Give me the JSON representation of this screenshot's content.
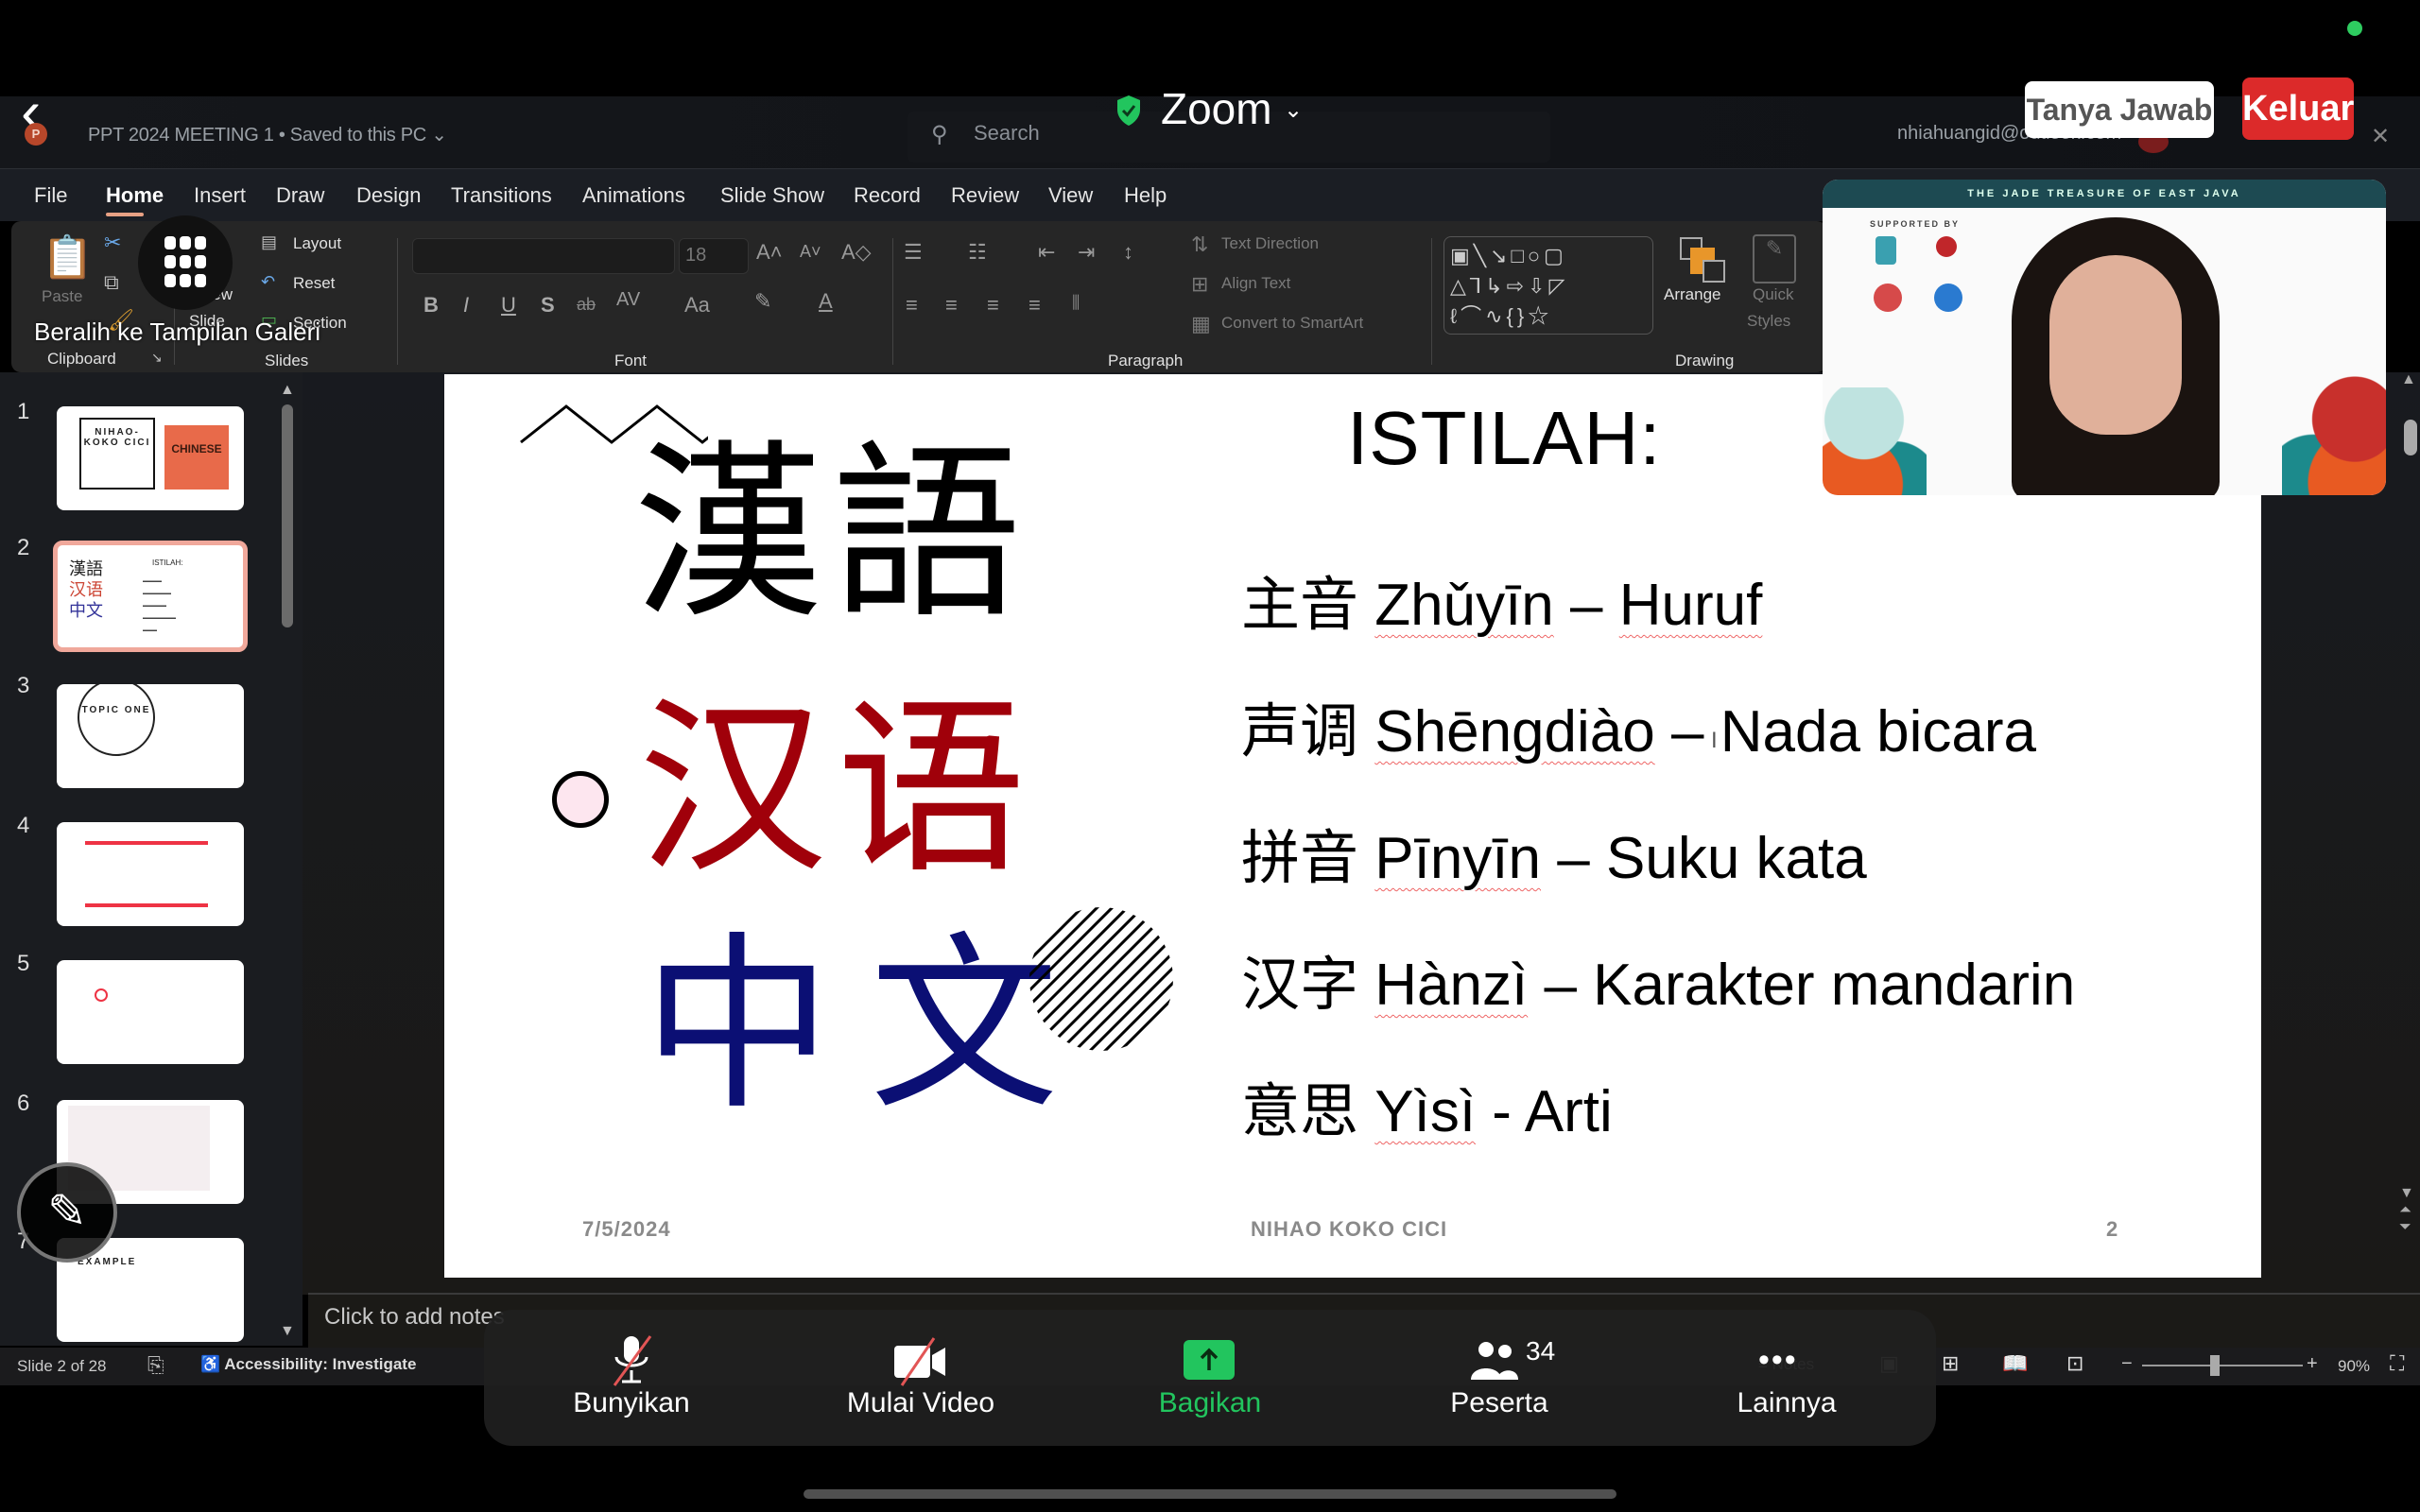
{
  "zoom_meeting": {
    "title": "Zoom",
    "qa_button": "Tanya Jawab",
    "leave_button": "Keluar",
    "controls": [
      {
        "id": "mute",
        "label": "Bunyikan",
        "icon": "microphone-muted-icon"
      },
      {
        "id": "video",
        "label": "Mulai Video",
        "icon": "video-off-icon"
      },
      {
        "id": "share",
        "label": "Bagikan",
        "icon": "share-screen-icon"
      },
      {
        "id": "participants",
        "label": "Peserta",
        "icon": "participants-icon",
        "count": "34"
      },
      {
        "id": "more",
        "label": "Lainnya",
        "icon": "more-icon"
      }
    ],
    "gallery_tooltip": "Beralih ke Tampilan Galeri",
    "video_tile": {
      "banner": "THE JADE TREASURE OF EAST JAVA",
      "supported_by": "SUPPORTED BY"
    },
    "colors": {
      "leave": "#dc2a2a",
      "share": "#22c55e",
      "status": "#2ecc60"
    }
  },
  "powerpoint": {
    "document_title": "PPT  2024 MEETING 1",
    "save_status": "Saved to this PC",
    "search_placeholder": "Search",
    "account_email": "nhiahuangid@outlook.com",
    "menu_tabs": [
      "File",
      "Home",
      "Insert",
      "Draw",
      "Design",
      "Transitions",
      "Animations",
      "Slide Show",
      "Record",
      "Review",
      "View",
      "Help"
    ],
    "active_tab": "Home",
    "ribbon": {
      "clipboard": {
        "group": "Clipboard",
        "paste": "Paste"
      },
      "slides": {
        "group": "Slides",
        "new_slide_1": "New",
        "new_slide_2": "Slide",
        "layout": "Layout",
        "reset": "Reset",
        "section": "Section"
      },
      "font": {
        "group": "Font",
        "font_name": "",
        "font_size": "18",
        "bold": "B",
        "italic": "I",
        "underline": "U",
        "shadow": "S",
        "strike": "ab",
        "spacing": "AV",
        "case": "Aa"
      },
      "paragraph": {
        "group": "Paragraph",
        "text_direction": "Text Direction",
        "align_text": "Align Text",
        "convert_smartart": "Convert to SmartArt"
      },
      "drawing": {
        "group": "Drawing",
        "arrange": "Arrange",
        "quick_styles_1": "Quick",
        "quick_styles_2": "Styles"
      }
    },
    "thumbnails": [
      {
        "num": "1",
        "title": "NIHAO-KOKO CICI",
        "subtitle": "CHINESE"
      },
      {
        "num": "2",
        "title": "ISTILAH:",
        "selected": true
      },
      {
        "num": "3",
        "title": "TOPIC ONE"
      },
      {
        "num": "4",
        "title": ""
      },
      {
        "num": "5",
        "title": ""
      },
      {
        "num": "6",
        "title": ""
      },
      {
        "num": "7",
        "title": "EXAMPLE"
      }
    ],
    "slide": {
      "chars_traditional": "漢語",
      "chars_simplified": "汉语",
      "chars_zhongwen": "中文",
      "heading": "ISTILAH:",
      "terms": [
        {
          "hanzi": "主音",
          "pinyin": "Zhǔyīn",
          "sep": "–",
          "meaning": "Huruf"
        },
        {
          "hanzi": "声调",
          "pinyin": "Shēngdiào",
          "sep": "–",
          "meaning": "Nada bicara"
        },
        {
          "hanzi": "拼音",
          "pinyin": "Pīnyīn",
          "sep": "–",
          "meaning": "Suku kata"
        },
        {
          "hanzi": "汉字",
          "pinyin": "Hànzì",
          "sep": "–",
          "meaning": "Karakter mandarin"
        },
        {
          "hanzi": "意思",
          "pinyin": "Yìsì",
          "sep": "-",
          "meaning": "Arti"
        }
      ],
      "footer_date": "7/5/2024",
      "footer_title": "NIHAO KOKO CICI",
      "footer_page": "2",
      "colors": {
        "red": "#a0000a",
        "blue": "#0b0f74",
        "pink": "#fde6ef"
      }
    },
    "notes_placeholder": "Click to add notes",
    "status": {
      "slide_count": "Slide 2 of 28",
      "accessibility": "Accessibility: Investigate",
      "notes": "Notes",
      "zoom_level": "90%",
      "zoom_fraction": 0.45
    }
  }
}
